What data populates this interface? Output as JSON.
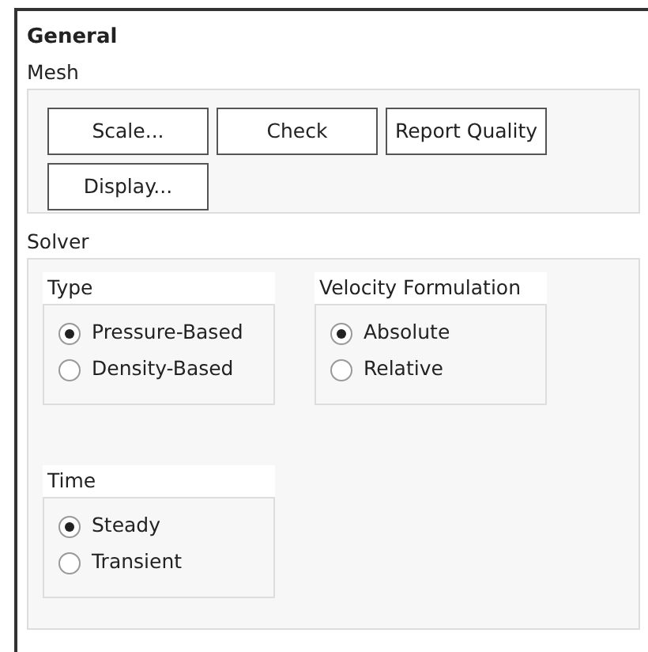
{
  "title": "General",
  "mesh": {
    "label": "Mesh",
    "buttons": [
      "Scale...",
      "Check",
      "Report Quality",
      "Display..."
    ]
  },
  "solver": {
    "label": "Solver",
    "groups": [
      {
        "label": "Type",
        "options": [
          {
            "label": "Pressure-Based",
            "selected": true
          },
          {
            "label": "Density-Based",
            "selected": false
          }
        ]
      },
      {
        "label": "Velocity Formulation",
        "options": [
          {
            "label": "Absolute",
            "selected": true
          },
          {
            "label": "Relative",
            "selected": false
          }
        ]
      },
      {
        "label": "Time",
        "options": [
          {
            "label": "Steady",
            "selected": true
          },
          {
            "label": "Transient",
            "selected": false
          }
        ]
      }
    ]
  }
}
